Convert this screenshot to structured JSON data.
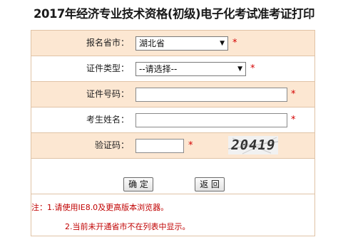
{
  "page": {
    "title": "2017年经济专业技术资格(初级)电子化考试准考证打印"
  },
  "form": {
    "province": {
      "label": "报名省市：",
      "selected": "湖北省",
      "required_mark": "*"
    },
    "cert_type": {
      "label": "证件类型：",
      "selected": "--请选择--",
      "required_mark": "*"
    },
    "cert_number": {
      "label": "证件号码：",
      "value": "",
      "required_mark": "*"
    },
    "name": {
      "label": "考生姓名：",
      "value": "",
      "required_mark": "*"
    },
    "captcha": {
      "label": "验证码：",
      "value": "",
      "required_mark": "*",
      "image_text": "20419"
    }
  },
  "buttons": {
    "confirm": "确 定",
    "back": "返 回"
  },
  "notes": {
    "line1": "注：1.请使用IE8.0及更高版本浏览器。",
    "line2": "2.当前未开通省市不在列表中显示。"
  },
  "colors": {
    "row_highlight": "#fce7d2",
    "border": "#e0c3a6",
    "required": "#d40000",
    "note_text": "#c00000"
  }
}
